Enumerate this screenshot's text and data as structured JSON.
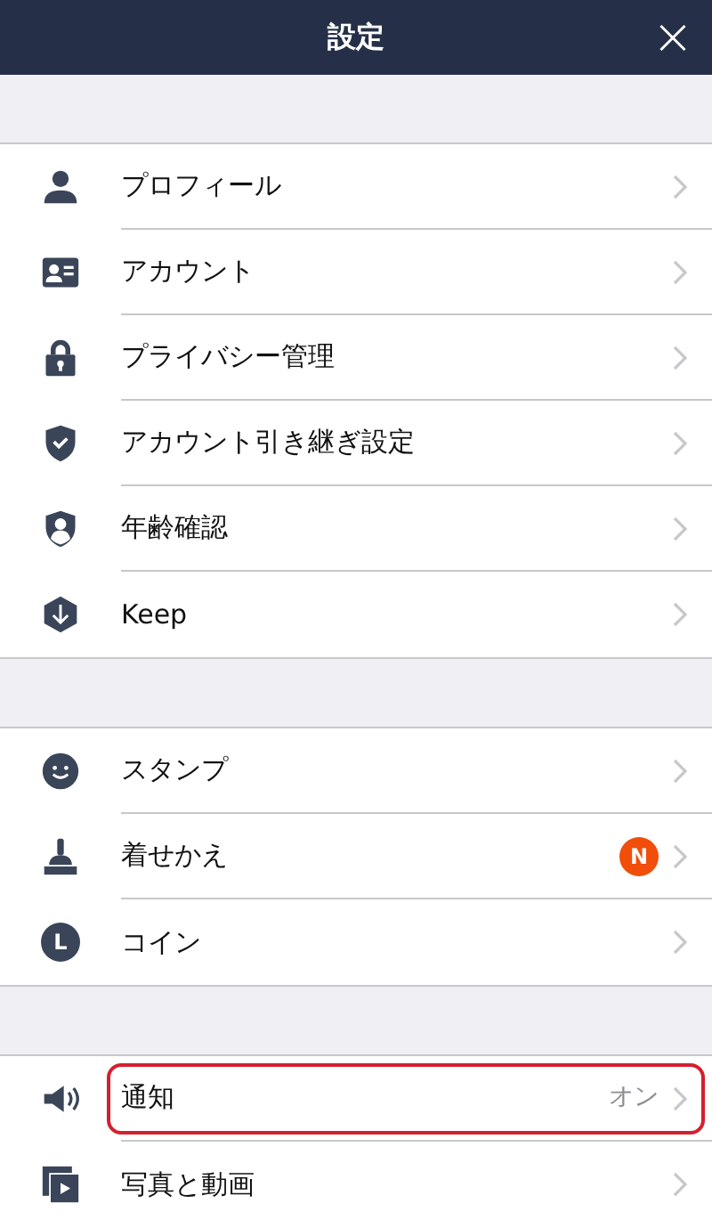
{
  "header": {
    "title": "設定",
    "close": "×"
  },
  "groups": [
    {
      "items": [
        {
          "kind": "person",
          "label": "プロフィール"
        },
        {
          "kind": "id-card",
          "label": "アカウント"
        },
        {
          "kind": "lock",
          "label": "プライバシー管理"
        },
        {
          "kind": "shield-check",
          "label": "アカウント引き継ぎ設定"
        },
        {
          "kind": "shield-person",
          "label": "年齢確認"
        },
        {
          "kind": "hexagon-down",
          "label": "Keep"
        }
      ]
    },
    {
      "items": [
        {
          "kind": "smiley",
          "label": "スタンプ"
        },
        {
          "kind": "brush",
          "label": "着せかえ",
          "badge": "N"
        },
        {
          "kind": "coin",
          "icon_letter": "L",
          "label": "コイン"
        }
      ]
    },
    {
      "items": [
        {
          "kind": "speaker",
          "label": "通知",
          "value": "オン",
          "highlighted": true
        },
        {
          "kind": "media",
          "label": "写真と動画"
        }
      ]
    }
  ]
}
